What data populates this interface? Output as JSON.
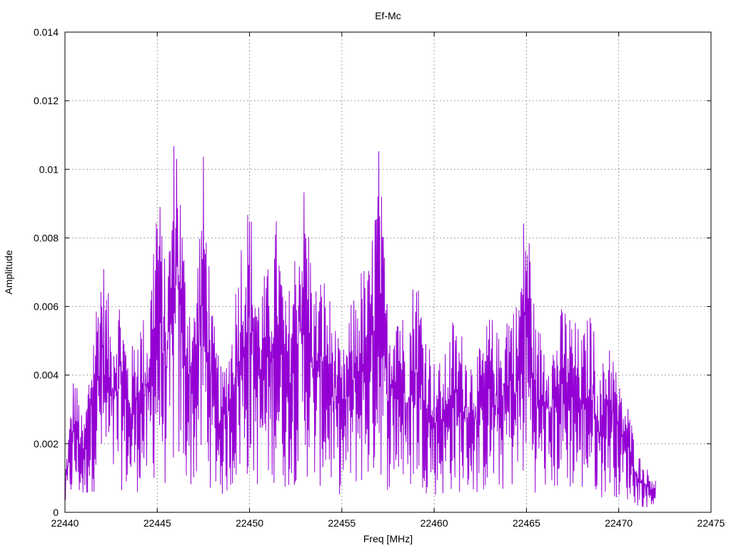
{
  "chart_data": {
    "type": "line",
    "title": "Ef-Mc",
    "xlabel": "Freq [MHz]",
    "ylabel": "Amplitude",
    "xlim": [
      22440,
      22475
    ],
    "ylim": [
      0,
      0.014
    ],
    "xticks": [
      "22440",
      "22445",
      "22450",
      "22455",
      "22460",
      "22465",
      "22470",
      "22475"
    ],
    "yticks": [
      "0",
      "0.002",
      "0.004",
      "0.006",
      "0.008",
      "0.01",
      "0.012",
      "0.014"
    ],
    "grid": true,
    "line_color": "#9400d3",
    "series": [
      {
        "x": [
          22440.0,
          22440.5,
          22441.0,
          22441.5,
          22442.0,
          22442.5,
          22443.0,
          22443.5,
          22444.0,
          22444.5,
          22445.0,
          22445.5,
          22446.0,
          22446.5,
          22447.0,
          22447.5,
          22448.0,
          22448.5,
          22449.0,
          22449.5,
          22450.0,
          22450.5,
          22451.0,
          22451.5,
          22452.0,
          22452.5,
          22453.0,
          22453.5,
          22454.0,
          22454.5,
          22455.0,
          22455.5,
          22456.0,
          22456.5,
          22457.0,
          22457.5,
          22458.0,
          22458.5,
          22459.0,
          22459.5,
          22460.0,
          22460.5,
          22461.0,
          22461.5,
          22462.0,
          22462.5,
          22463.0,
          22463.5,
          22464.0,
          22464.5,
          22465.0,
          22465.5,
          22466.0,
          22466.5,
          22467.0,
          22467.5,
          22468.0,
          22468.5,
          22469.0,
          22469.5,
          22470.0,
          22470.5,
          22471.0,
          22471.5,
          22472.0
        ],
        "y": [
          0.0012,
          0.0043,
          0.0025,
          0.0055,
          0.0078,
          0.0058,
          0.0066,
          0.0045,
          0.0059,
          0.0057,
          0.0102,
          0.0068,
          0.0122,
          0.0075,
          0.0062,
          0.0105,
          0.0058,
          0.0041,
          0.0055,
          0.0082,
          0.0093,
          0.0067,
          0.0072,
          0.0088,
          0.006,
          0.0081,
          0.0099,
          0.0067,
          0.0071,
          0.006,
          0.0045,
          0.0061,
          0.0072,
          0.0073,
          0.0108,
          0.0059,
          0.007,
          0.0052,
          0.0075,
          0.0057,
          0.0045,
          0.0044,
          0.0057,
          0.0053,
          0.0047,
          0.0048,
          0.0059,
          0.0052,
          0.0064,
          0.0062,
          0.0098,
          0.0055,
          0.0054,
          0.0052,
          0.0062,
          0.0058,
          0.0052,
          0.006,
          0.004,
          0.0055,
          0.0038,
          0.0032,
          0.0018,
          0.0013,
          0.0011
        ]
      }
    ]
  }
}
